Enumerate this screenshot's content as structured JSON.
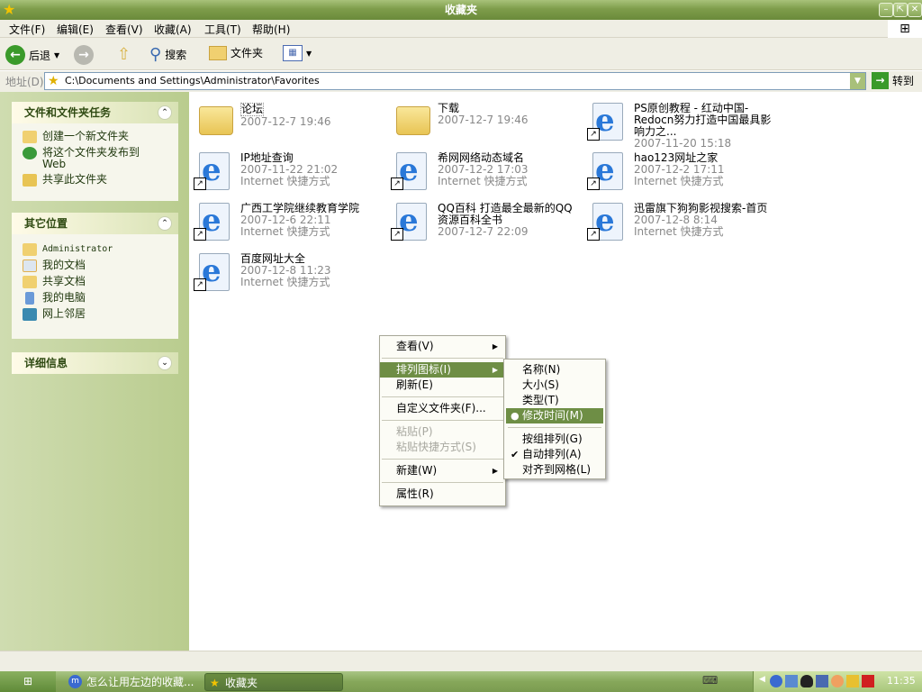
{
  "window": {
    "title": "收藏夹",
    "min": "–",
    "restore": "⇱",
    "close": "✕"
  },
  "menubar": [
    "文件(F)",
    "编辑(E)",
    "查看(V)",
    "收藏(A)",
    "工具(T)",
    "帮助(H)"
  ],
  "toolbar": {
    "back": "后退",
    "search": "搜索",
    "folders": "文件夹"
  },
  "address": {
    "label": "地址(D)",
    "value": "C:\\Documents and Settings\\Administrator\\Favorites",
    "go": "转到"
  },
  "left_panel": {
    "tasks": {
      "title": "文件和文件夹任务",
      "items": [
        "创建一个新文件夹",
        "将这个文件夹发布到 Web",
        "共享此文件夹"
      ]
    },
    "places": {
      "title": "其它位置",
      "items": [
        "Administrator",
        "我的文档",
        "共享文档",
        "我的电脑",
        "网上邻居"
      ]
    },
    "details": {
      "title": "详细信息"
    }
  },
  "items": [
    {
      "name": "论坛",
      "date": "2007-12-7 19:46",
      "type": "",
      "kind": "folder"
    },
    {
      "name": "下载",
      "date": "2007-12-7 19:46",
      "type": "",
      "kind": "folder"
    },
    {
      "name": "PS原创教程 - 红动中国-Redocn努力打造中国最具影响力之...",
      "date": "2007-11-20 15:18",
      "type": "",
      "kind": "ie"
    },
    {
      "name": "IP地址查询",
      "date": "2007-11-22 21:02",
      "type": "Internet 快捷方式",
      "kind": "ie"
    },
    {
      "name": "希网网络动态域名",
      "date": "2007-12-2 17:03",
      "type": "Internet 快捷方式",
      "kind": "ie"
    },
    {
      "name": "hao123网址之家",
      "date": "2007-12-2 17:11",
      "type": "Internet 快捷方式",
      "kind": "ie"
    },
    {
      "name": "广西工学院继续教育学院",
      "date": "2007-12-6 22:11",
      "type": "Internet 快捷方式",
      "kind": "ie"
    },
    {
      "name": "QQ百科 打造最全最新的QQ资源百科全书",
      "date": "2007-12-7 22:09",
      "type": "",
      "kind": "ie"
    },
    {
      "name": "迅雷旗下狗狗影视搜索-首页",
      "date": "2007-12-8 8:14",
      "type": "Internet 快捷方式",
      "kind": "ie"
    },
    {
      "name": "百度网址大全",
      "date": "2007-12-8 11:23",
      "type": "Internet 快捷方式",
      "kind": "ie"
    }
  ],
  "context_menu": {
    "view": "查看(V)",
    "arrange": "排列图标(I)",
    "refresh": "刷新(E)",
    "customize": "自定义文件夹(F)...",
    "paste": "粘贴(P)",
    "paste_shortcut": "粘贴快捷方式(S)",
    "new": "新建(W)",
    "properties": "属性(R)"
  },
  "submenu": {
    "name": "名称(N)",
    "size": "大小(S)",
    "type": "类型(T)",
    "modified": "修改时间(M)",
    "group": "按组排列(G)",
    "auto": "自动排列(A)",
    "align": "对齐到网格(L)"
  },
  "taskbar": {
    "task1": "怎么让用左边的收藏...",
    "task2": "收藏夹",
    "clock": "11:35"
  }
}
